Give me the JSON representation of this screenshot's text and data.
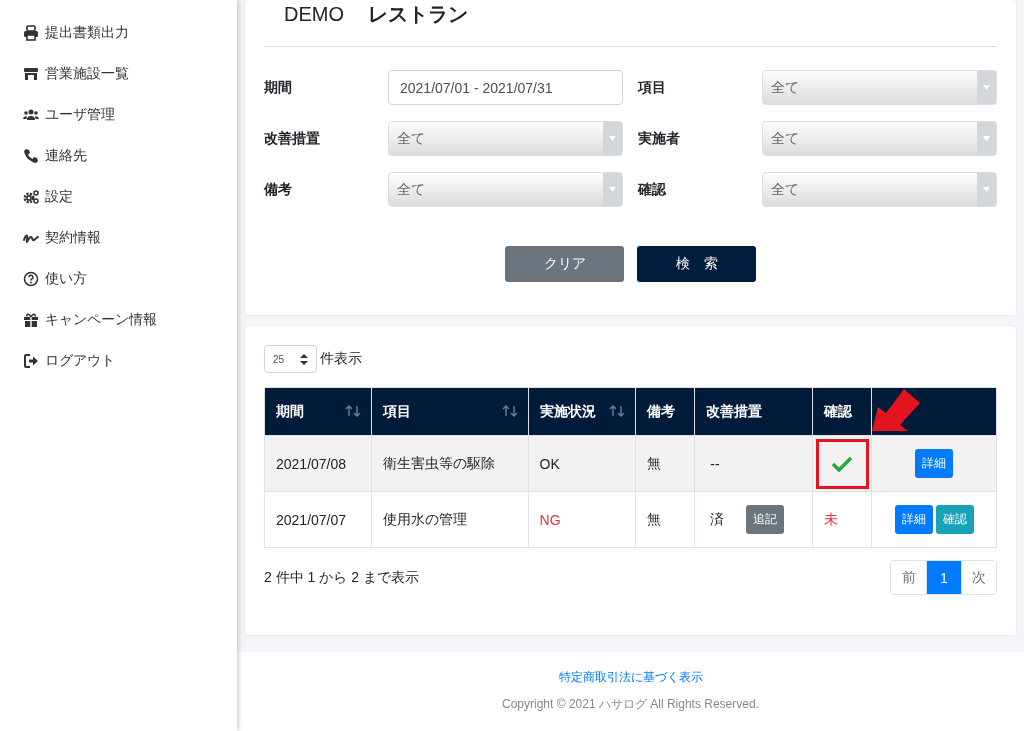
{
  "sidebar": {
    "items": [
      {
        "label": "提出書類出力"
      },
      {
        "label": "営業施設一覧"
      },
      {
        "label": "ユーザ管理"
      },
      {
        "label": "連絡先"
      },
      {
        "label": "設定"
      },
      {
        "label": "契約情報"
      },
      {
        "label": "使い方"
      },
      {
        "label": "キャンペーン情報"
      },
      {
        "label": "ログアウト"
      }
    ]
  },
  "header": {
    "code": "DEMO",
    "name": "レストラン"
  },
  "filters": [
    {
      "label": "期間",
      "kind": "text",
      "value": "2021/07/01 - 2021/07/31"
    },
    {
      "label": "項目",
      "kind": "select",
      "value": "全て"
    },
    {
      "label": "改善措置",
      "kind": "select",
      "value": "全て"
    },
    {
      "label": "実施者",
      "kind": "select",
      "value": "全て"
    },
    {
      "label": "備考",
      "kind": "select",
      "value": "全て"
    },
    {
      "label": "確認",
      "kind": "select",
      "value": "全て"
    }
  ],
  "actions": [
    {
      "label": "クリア",
      "kind": "secondary"
    },
    {
      "label": "検　索",
      "kind": "primary"
    }
  ],
  "page_size": {
    "value": "25",
    "label": "件表示"
  },
  "table": {
    "columns": [
      {
        "label": "期間",
        "sortable": true
      },
      {
        "label": "項目",
        "sortable": true
      },
      {
        "label": "実施状況",
        "sortable": true
      },
      {
        "label": "備考",
        "sortable": false
      },
      {
        "label": "改善措置",
        "sortable": false
      },
      {
        "label": "確認",
        "sortable": false
      },
      {
        "sortable": false
      }
    ],
    "rows": [
      {
        "date": "2021/07/08",
        "item": "衛生害虫等の駆除",
        "status": "OK",
        "status_alert": false,
        "note": "無",
        "measure": "--",
        "measure_button": null,
        "confirm": {
          "kind": "check"
        },
        "highlighted": true,
        "buttons": [
          {
            "label": "詳細",
            "kind": "detail"
          }
        ]
      },
      {
        "date": "2021/07/07",
        "item": "使用水の管理",
        "status": "NG",
        "status_alert": true,
        "note": "無",
        "measure": "済",
        "measure_button": "追記",
        "confirm": {
          "kind": "pending",
          "text": "未"
        },
        "highlighted": false,
        "buttons": [
          {
            "label": "詳細",
            "kind": "detail"
          },
          {
            "label": "確認",
            "kind": "confirm"
          }
        ]
      }
    ]
  },
  "table_info": "2 件中 1 から 2 まで表示",
  "pagination": [
    {
      "label": "前",
      "selected": false
    },
    {
      "label": "1",
      "selected": true
    },
    {
      "label": "次",
      "selected": false
    }
  ],
  "footer": {
    "link": "特定商取引法に基づく表示",
    "copyright": "Copyright © 2021 ハサログ All Rights Reserved."
  }
}
